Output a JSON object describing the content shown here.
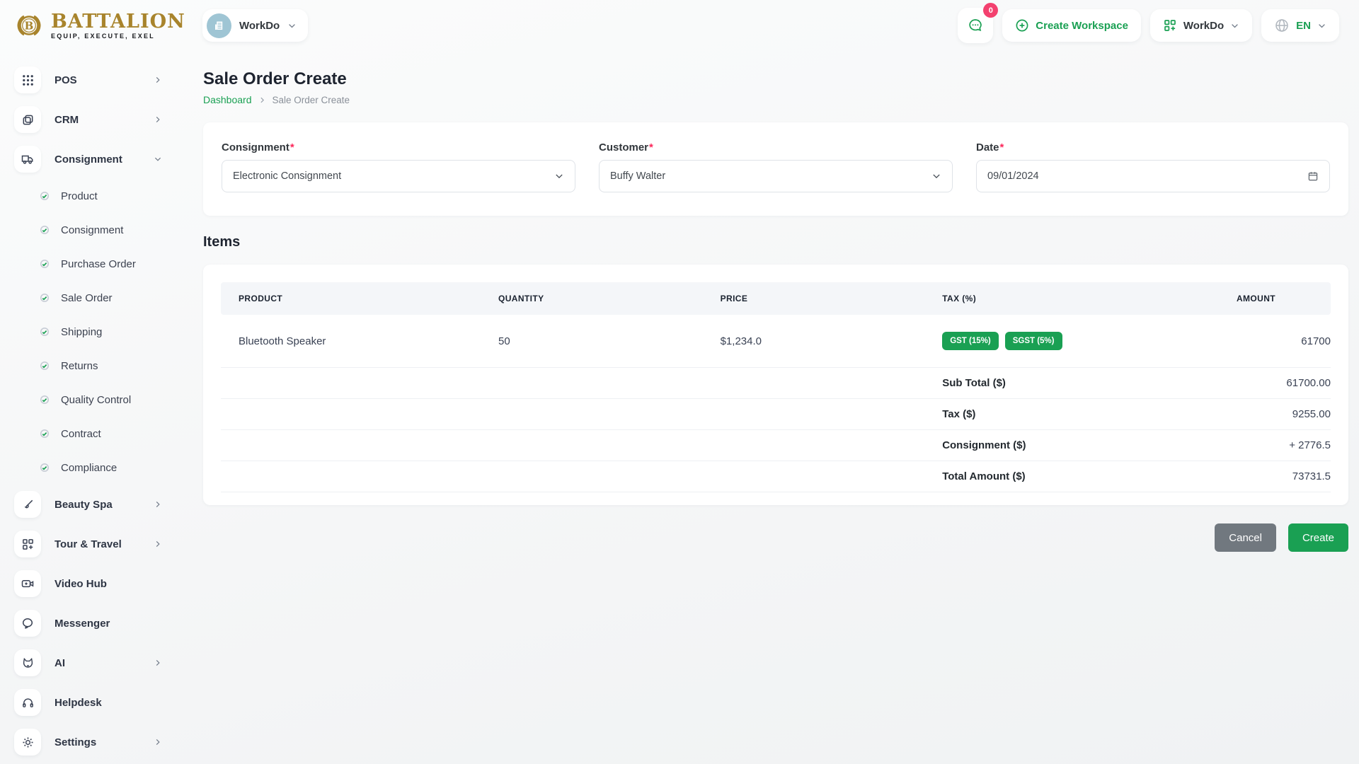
{
  "brand": {
    "name": "BATTALION",
    "tagline": "EQUIP, EXECUTE, EXEL",
    "monogram": "B"
  },
  "topbar": {
    "workspace_switcher": {
      "label": "WorkDo"
    },
    "messages_badge": "0",
    "create_workspace_label": "Create Workspace",
    "workdo_menu_label": "WorkDo",
    "language": "EN"
  },
  "sidebar": {
    "pos": "POS",
    "crm": "CRM",
    "consignment": "Consignment",
    "consignment_children": [
      "Product",
      "Consignment",
      "Purchase Order",
      "Sale Order",
      "Shipping",
      "Returns",
      "Quality Control",
      "Contract",
      "Compliance"
    ],
    "beauty_spa": "Beauty Spa",
    "tour_travel": "Tour & Travel",
    "video_hub": "Video Hub",
    "messenger": "Messenger",
    "ai": "AI",
    "helpdesk": "Helpdesk",
    "settings": "Settings"
  },
  "page": {
    "title": "Sale Order Create",
    "breadcrumb": {
      "home": "Dashboard",
      "current": "Sale Order Create"
    }
  },
  "form": {
    "consignment": {
      "label": "Consignment",
      "required": "*",
      "value": "Electronic Consignment"
    },
    "customer": {
      "label": "Customer",
      "required": "*",
      "value": "Buffy Walter"
    },
    "date": {
      "label": "Date",
      "required": "*",
      "value": "09/01/2024"
    }
  },
  "items_section": {
    "heading": "Items",
    "table": {
      "columns": {
        "product": "PRODUCT",
        "quantity": "QUANTITY",
        "price": "PRICE",
        "tax": "TAX (%)",
        "amount": "AMOUNT"
      },
      "rows": [
        {
          "product": "Bluetooth Speaker",
          "quantity": "50",
          "price": "$1,234.0",
          "taxes": [
            "GST (15%)",
            "SGST (5%)"
          ],
          "amount": "61700"
        }
      ],
      "totals": [
        {
          "label": "Sub Total ($)",
          "value": "61700.00"
        },
        {
          "label": "Tax ($)",
          "value": "9255.00"
        },
        {
          "label": "Consignment ($)",
          "value": "+ 2776.5"
        },
        {
          "label": "Total Amount ($)",
          "value": "73731.5"
        }
      ]
    }
  },
  "actions": {
    "cancel": "Cancel",
    "create": "Create"
  },
  "colors": {
    "accent_green": "#1aa053",
    "danger_pink": "#fc275a",
    "badge_pink": "#f3416f",
    "brand_gold": "#a8842c",
    "cancel_gray": "#71787f",
    "workspace_blue": "#9fc5d4"
  }
}
